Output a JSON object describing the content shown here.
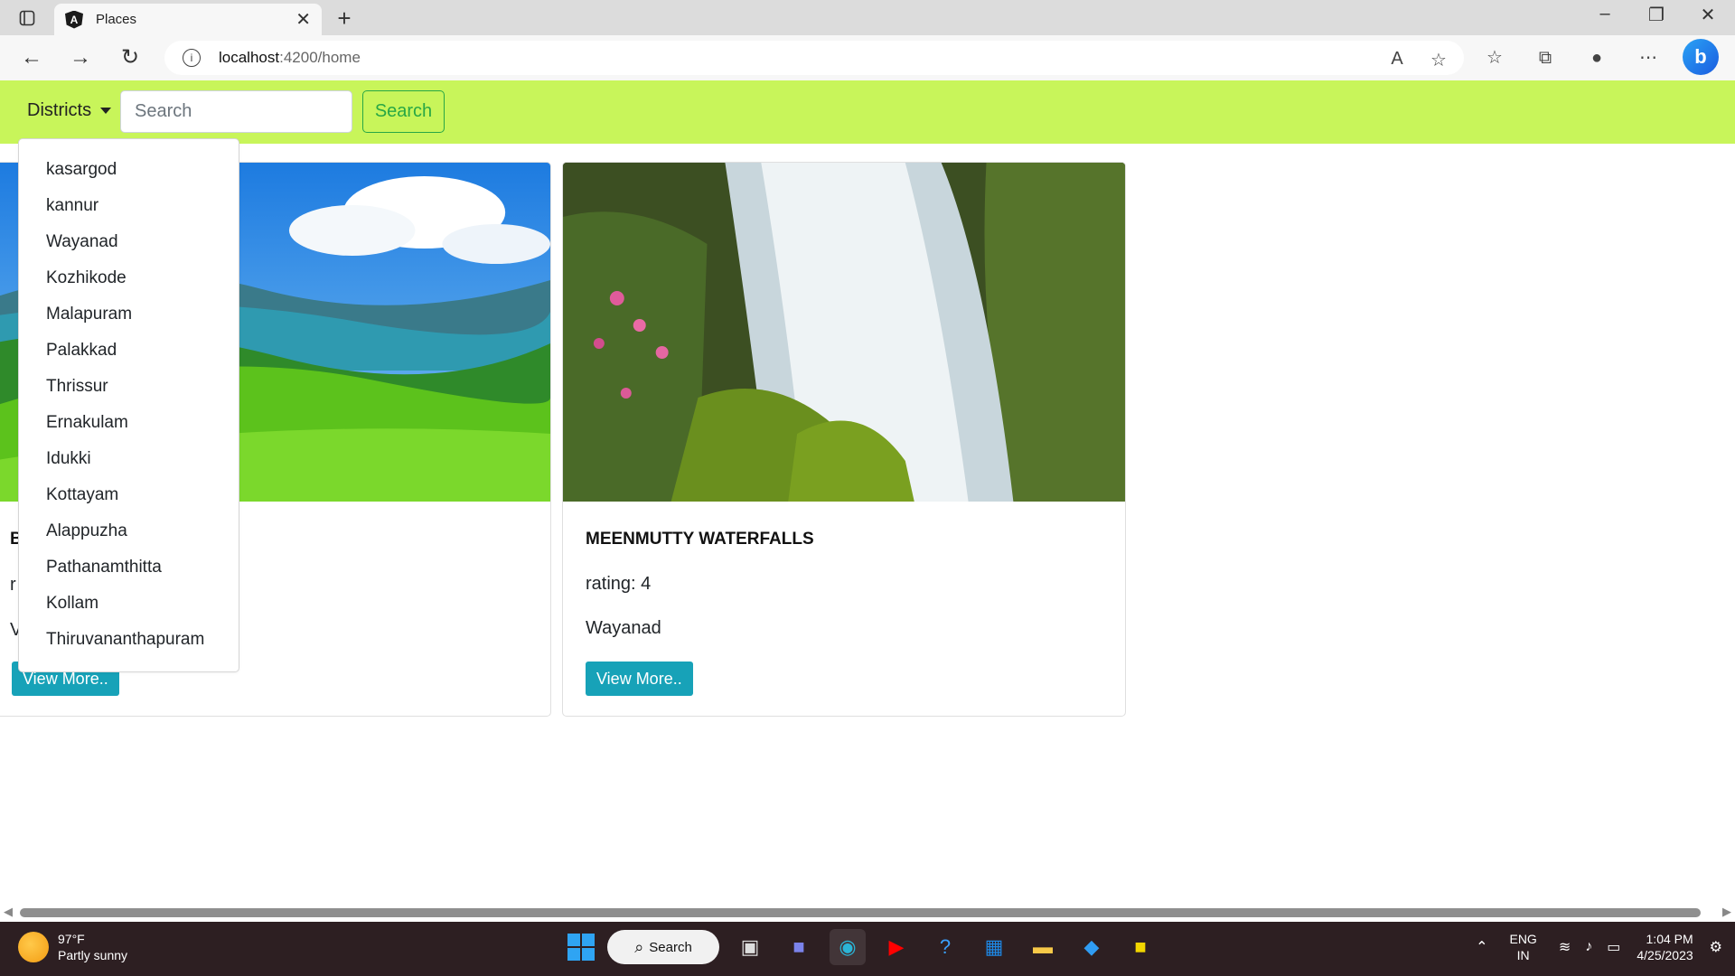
{
  "browser": {
    "tab_title": "Places",
    "url_host": "localhost",
    "url_path": ":4200/home"
  },
  "navbar": {
    "dropdown_label": "Districts",
    "search_placeholder": "Search",
    "search_button": "Search"
  },
  "districts": [
    "kasargod",
    "kannur",
    "Wayanad",
    "Kozhikode",
    "Malapuram",
    "Palakkad",
    "Thrissur",
    "Ernakulam",
    "Idukki",
    "Kottayam",
    "Alappuzha",
    "Pathanamthitta",
    "Kollam",
    "Thiruvananthapuram"
  ],
  "cards": [
    {
      "title": "B",
      "rating": "r",
      "district": "V",
      "button": "View More.."
    },
    {
      "title": "MEENMUTTY WATERFALLS",
      "rating": "rating: 4",
      "district": "Wayanad",
      "button": "View More.."
    }
  ],
  "taskbar": {
    "temperature": "97°F",
    "weather": "Partly sunny",
    "search_label": "Search",
    "language": "ENG",
    "region": "IN",
    "time": "1:04 PM",
    "date": "4/25/2023"
  }
}
